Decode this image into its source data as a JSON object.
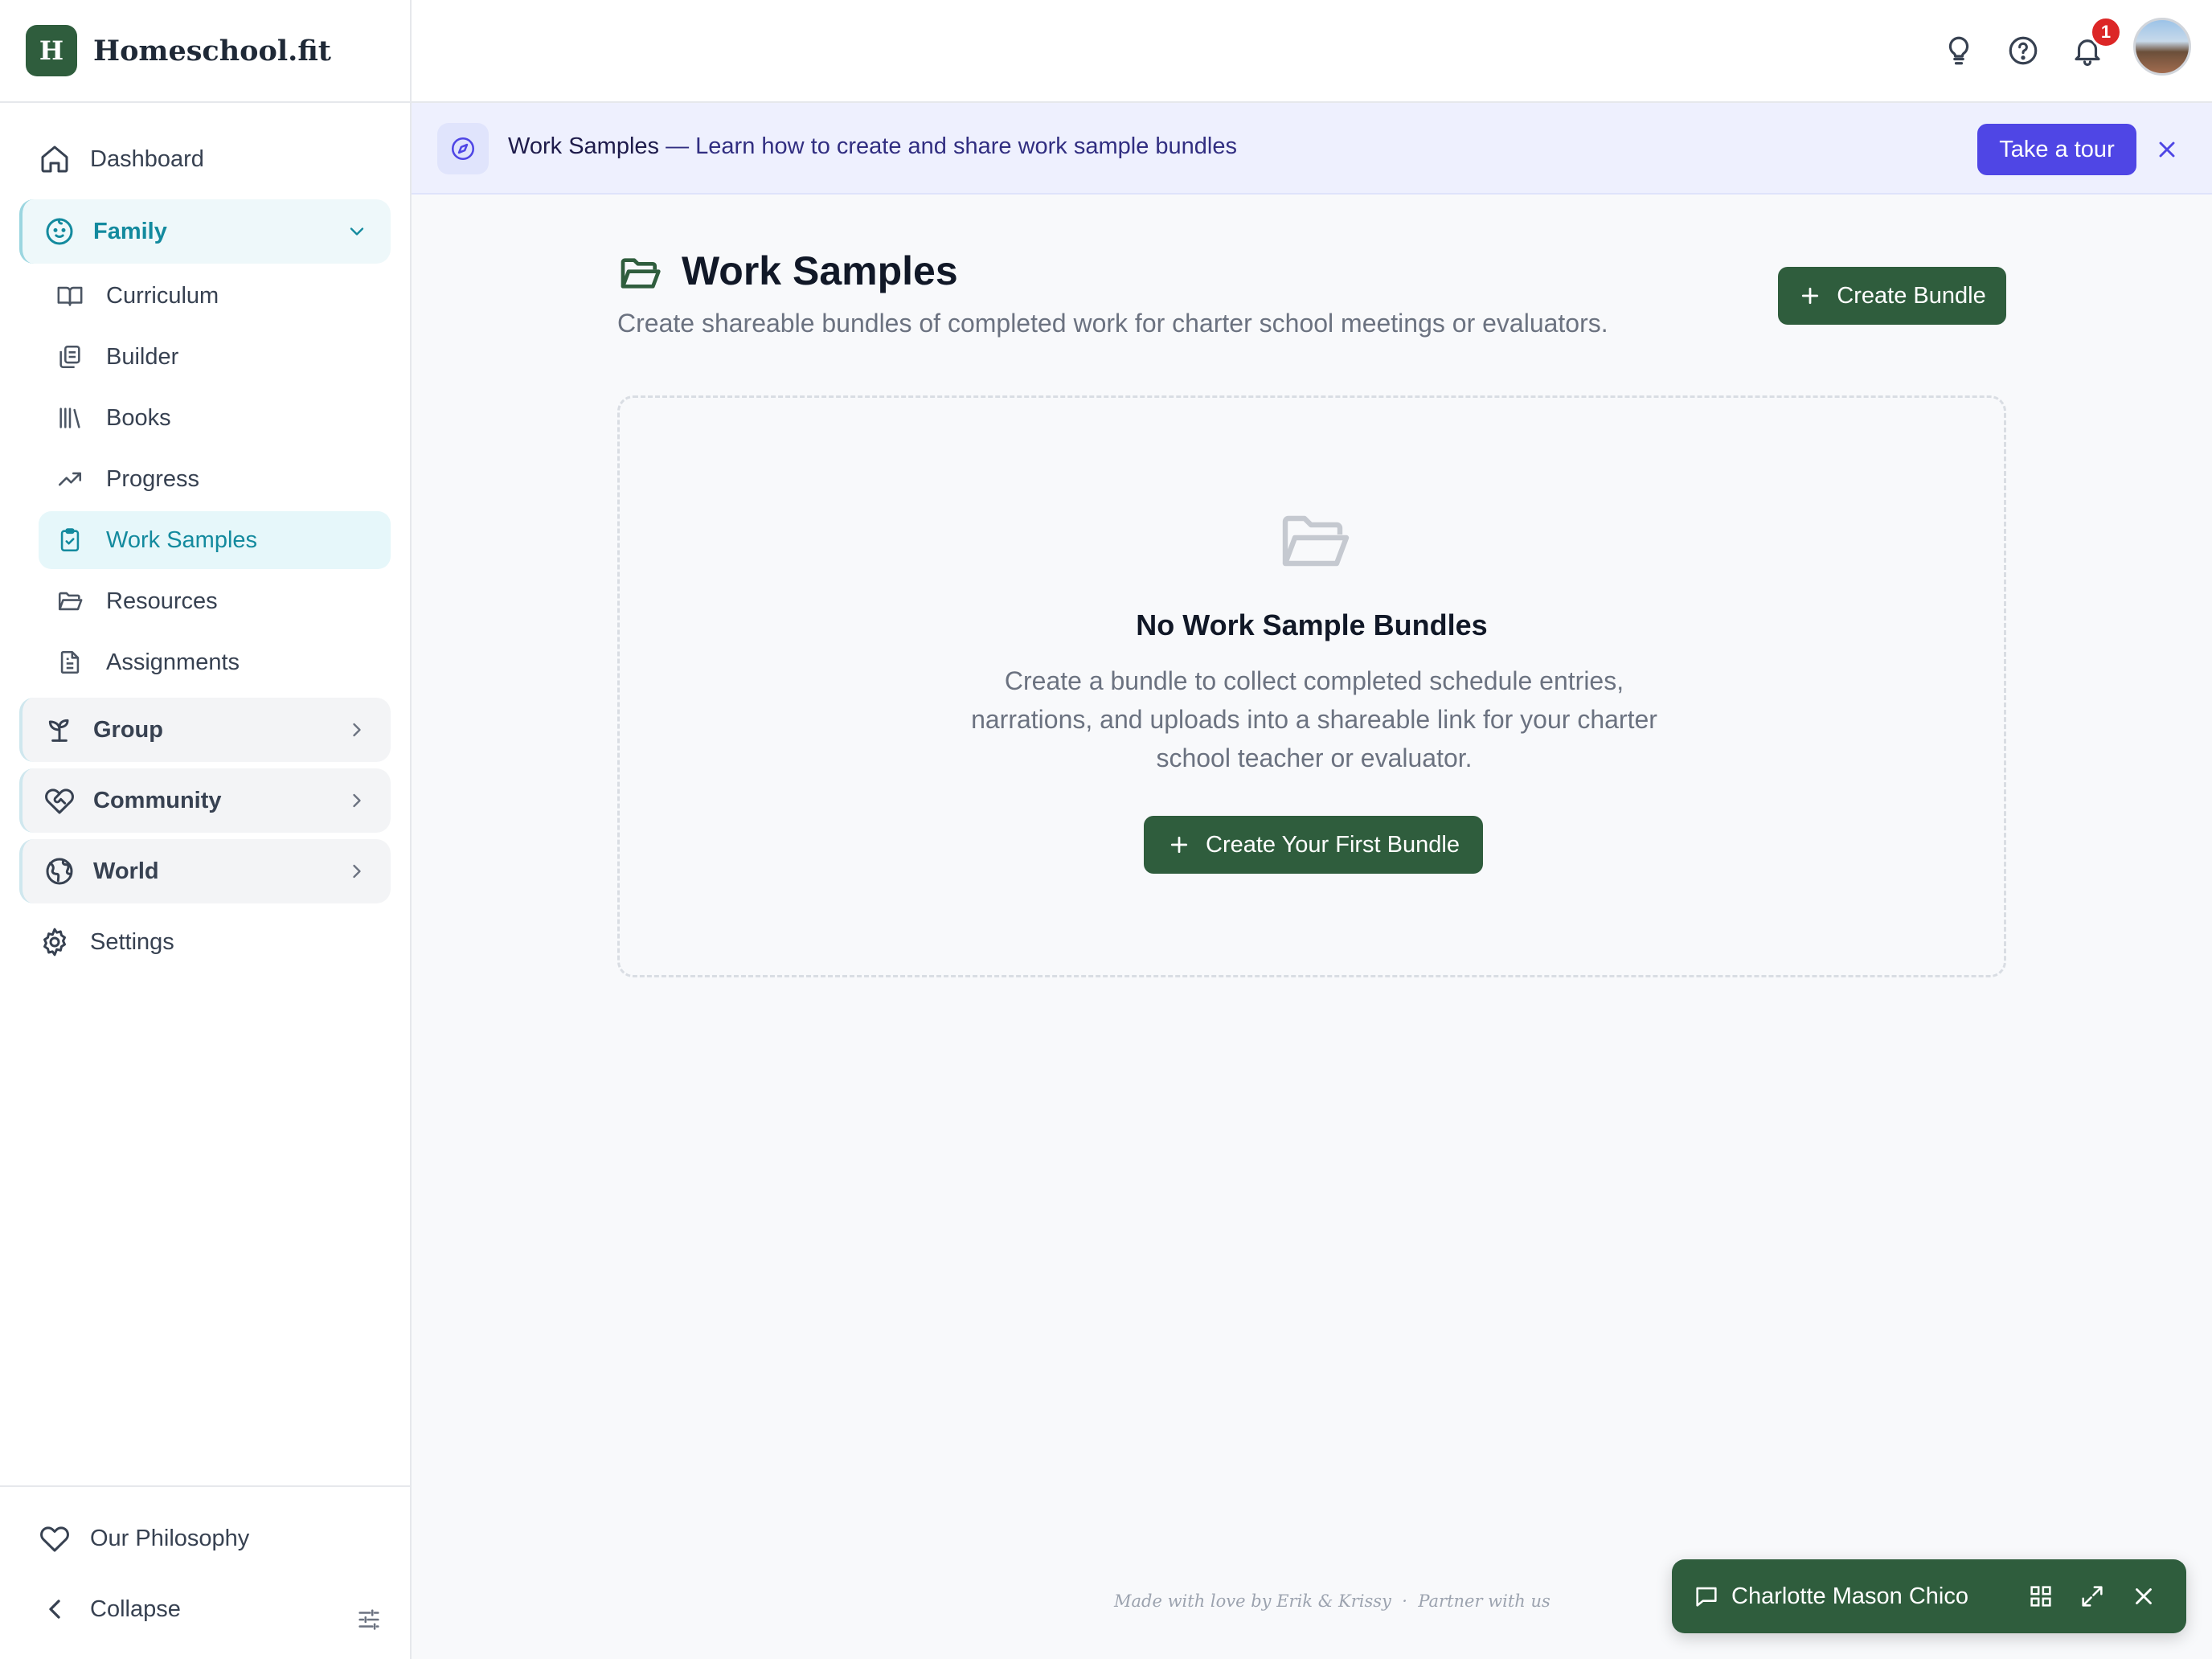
{
  "brand": {
    "logo_letter": "H",
    "name": "Homeschool.fit"
  },
  "sidebar": {
    "dashboard": "Dashboard",
    "family": "Family",
    "family_items": [
      "Curriculum",
      "Builder",
      "Books",
      "Progress",
      "Work Samples",
      "Resources",
      "Assignments"
    ],
    "active_item": "Work Samples",
    "group": "Group",
    "community": "Community",
    "world": "World",
    "settings": "Settings",
    "our_philosophy": "Our Philosophy",
    "collapse": "Collapse"
  },
  "topbar": {
    "icons": [
      "lightbulb-icon",
      "help-icon",
      "bell-icon"
    ],
    "notification_count": "1"
  },
  "tour_banner": {
    "title": "Work Samples",
    "text": " — Learn how to create and share work sample bundles",
    "button": "Take a tour"
  },
  "main": {
    "title": "Work Samples",
    "subtitle": "Create shareable bundles of completed work for charter school meetings or evaluators.",
    "create_button": "Create Bundle",
    "empty_title": "No Work Sample Bundles",
    "empty_desc": "Create a bundle to collect completed schedule entries, narrations, and uploads into a shareable link for your charter school teacher or evaluator.",
    "empty_button": "Create Your First Bundle"
  },
  "footer": {
    "made_with": "Made with love by Erik & Krissy",
    "separator": "·",
    "partner": "Partner with us"
  },
  "chat": {
    "label": "Charlotte Mason Chico"
  },
  "colors": {
    "brand_green": "#2f5d3d",
    "accent_teal": "#138a9e",
    "tour_indigo": "#4f46e5",
    "badge_red": "#dc2626"
  }
}
